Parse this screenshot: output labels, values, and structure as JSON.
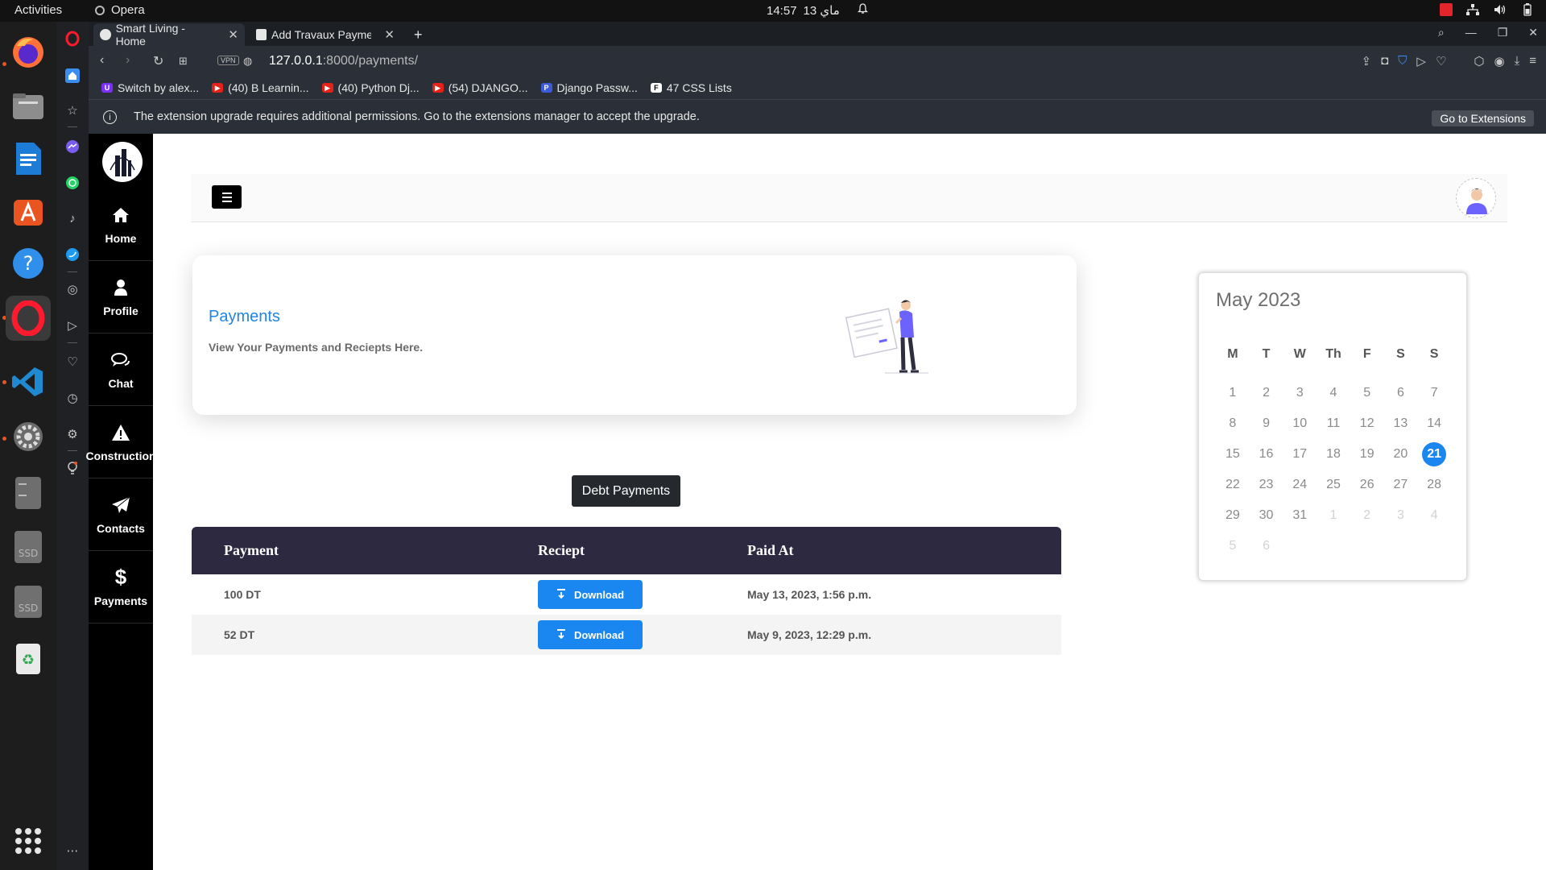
{
  "os": {
    "activities": "Activities",
    "active_app": "Opera",
    "clock": "14:57",
    "date_arabic": "ماي 13"
  },
  "browser": {
    "tabs": [
      {
        "label": "Smart Living - Home",
        "active": true
      },
      {
        "label": "Add Travaux Paymen",
        "active": false
      }
    ],
    "url_host": "127.0.0.1",
    "url_path": ":8000/payments/",
    "vpn_label": "VPN",
    "bookmarks": [
      {
        "label": "Switch by alex...",
        "icon": "u-icon",
        "color": "#7b2ff7"
      },
      {
        "label": "(40) B Learnin...",
        "icon": "youtube-icon",
        "color": "#e62117"
      },
      {
        "label": "(40) Python Dj...",
        "icon": "youtube-icon",
        "color": "#e62117"
      },
      {
        "label": "(54) DJANGO...",
        "icon": "youtube-icon",
        "color": "#e62117"
      },
      {
        "label": "Django Passw...",
        "icon": "p-icon",
        "color": "#3b5bdb"
      },
      {
        "label": "47 CSS Lists",
        "icon": "f-icon",
        "color": "#ffffff"
      }
    ],
    "info_message": "The extension upgrade requires additional permissions. Go to the extensions manager to accept the upgrade.",
    "go_to_extensions": "Go to Extensions"
  },
  "sidebar_nav": [
    {
      "label": "Home",
      "icon": "home-icon"
    },
    {
      "label": "Profile",
      "icon": "user-icon"
    },
    {
      "label": "Chat",
      "icon": "chat-icon"
    },
    {
      "label": "Construction",
      "icon": "warning-icon"
    },
    {
      "label": "Contacts",
      "icon": "paper-plane-icon"
    },
    {
      "label": "Payments",
      "icon": "dollar-icon"
    }
  ],
  "card": {
    "title": "Payments",
    "subtitle": "View Your Payments and Reciepts Here."
  },
  "debt_button": "Debt Payments",
  "table": {
    "headers": [
      "Payment",
      "Reciept",
      "Paid At"
    ],
    "rows": [
      {
        "payment": "100 DT",
        "button": "Download",
        "paid_at": "May 13, 2023, 1:56 p.m."
      },
      {
        "payment": "52 DT",
        "button": "Download",
        "paid_at": "May 9, 2023, 12:29 p.m."
      }
    ]
  },
  "calendar": {
    "title": "May 2023",
    "weekdays": [
      "M",
      "T",
      "W",
      "Th",
      "F",
      "S",
      "S"
    ],
    "weeks": [
      [
        "1",
        "2",
        "3",
        "4",
        "5",
        "6",
        "7"
      ],
      [
        "8",
        "9",
        "10",
        "11",
        "12",
        "13",
        "14"
      ],
      [
        "15",
        "16",
        "17",
        "18",
        "19",
        "20",
        "21"
      ],
      [
        "22",
        "23",
        "24",
        "25",
        "26",
        "27",
        "28"
      ],
      [
        "29",
        "30",
        "31",
        "1",
        "2",
        "3",
        "4"
      ],
      [
        "5",
        "6",
        "",
        "",
        "",
        "",
        ""
      ]
    ],
    "today": "21",
    "accent": "#1a87f0"
  },
  "colors": {
    "table_header": "#2d2940",
    "link_blue": "#1f85e6",
    "button_blue": "#1a87f0"
  }
}
